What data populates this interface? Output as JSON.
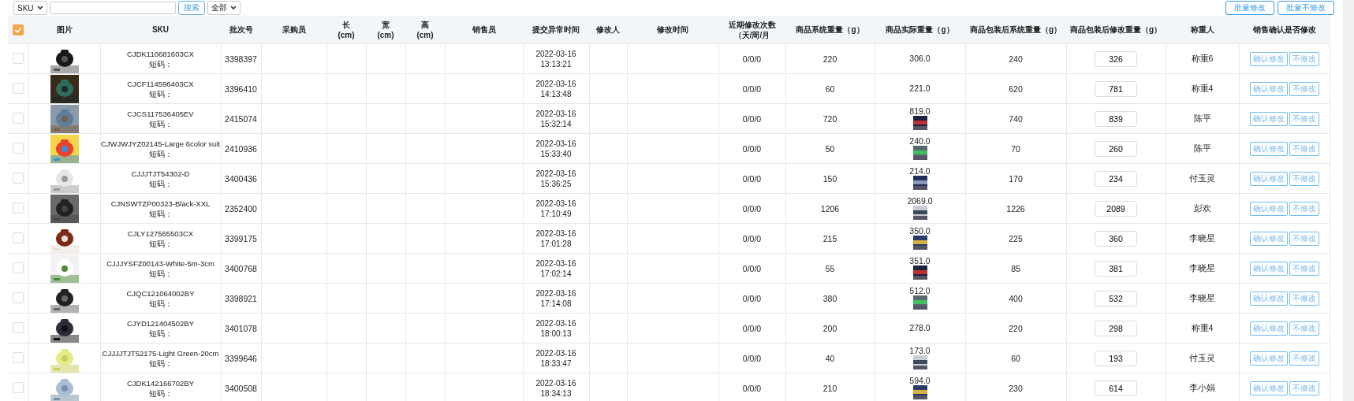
{
  "toolbar": {
    "search_type": "SKU",
    "search_button": "搜索",
    "filter": "全部",
    "batch_buttons": [
      "批量修改",
      "批量不修改"
    ]
  },
  "table": {
    "header_checked": true,
    "columns": [
      "图片",
      "SKU",
      "批次号",
      "采购员",
      "长 (cm)",
      "宽 (cm)",
      "高 (cm)",
      "销售员",
      "提交异常时间",
      "修改人",
      "修改时间",
      "近期修改次数（天/周/月",
      "商品系统重量（g）",
      "商品实际重量（g）",
      "商品包装后系统重量（g）",
      "商品包装后修改重量（g）",
      "称重人",
      "销售确认是否修改"
    ],
    "rows": [
      {
        "checked": false,
        "sku": "CJDK110681603CX",
        "short_code": "短码：",
        "batch": "3398397",
        "submitted": "2022-03-16 13:13:21",
        "recent_changes": "0/0/0",
        "system_weight": "220",
        "actual_weight": "306.0",
        "actual_photo": false,
        "packed_system_weight": "240",
        "packed_modified_weight": "326",
        "weigher": "称重6",
        "actions": [
          "确认修改",
          "不修改"
        ]
      },
      {
        "checked": false,
        "sku": "CJCF114596403CX",
        "short_code": "短码：",
        "batch": "3396410",
        "submitted": "2022-03-16 14:13:48",
        "recent_changes": "0/0/0",
        "system_weight": "60",
        "actual_weight": "221.0",
        "actual_photo": false,
        "packed_system_weight": "620",
        "packed_modified_weight": "781",
        "weigher": "称重4",
        "actions": [
          "确认修改",
          "不修改"
        ]
      },
      {
        "checked": false,
        "sku": "CJCS117536405EV",
        "short_code": "短码：",
        "batch": "2415074",
        "submitted": "2022-03-16 15:32:14",
        "recent_changes": "0/0/0",
        "system_weight": "720",
        "actual_weight": "819.0",
        "actual_photo": true,
        "packed_system_weight": "740",
        "packed_modified_weight": "839",
        "weigher": "陈平",
        "actions": [
          "确认修改",
          "不修改"
        ]
      },
      {
        "checked": false,
        "sku": "CJWJWJYZ02145-Large 6color suit",
        "short_code": "短码：",
        "batch": "2410936",
        "submitted": "2022-03-16 15:33:40",
        "recent_changes": "0/0/0",
        "system_weight": "50",
        "actual_weight": "240.0",
        "actual_photo": true,
        "packed_system_weight": "70",
        "packed_modified_weight": "260",
        "weigher": "陈平",
        "actions": [
          "确认修改",
          "不修改"
        ]
      },
      {
        "checked": false,
        "sku": "CJJJTJT54302-D",
        "short_code": "短码：",
        "batch": "3400436",
        "submitted": "2022-03-16 15:36:25",
        "recent_changes": "0/0/0",
        "system_weight": "150",
        "actual_weight": "214.0",
        "actual_photo": true,
        "packed_system_weight": "170",
        "packed_modified_weight": "234",
        "weigher": "付玉灵",
        "actions": [
          "确认修改",
          "不修改"
        ]
      },
      {
        "checked": false,
        "sku": "CJNSWTZP00323-Black-XXL",
        "short_code": "短码：",
        "batch": "2352400",
        "submitted": "2022-03-16 17:10:49",
        "recent_changes": "0/0/0",
        "system_weight": "1206",
        "actual_weight": "2069.0",
        "actual_photo": true,
        "packed_system_weight": "1226",
        "packed_modified_weight": "2089",
        "weigher": "彭欢",
        "actions": [
          "确认修改",
          "不修改"
        ]
      },
      {
        "checked": false,
        "sku": "CJLY127565503CX",
        "short_code": "短码：",
        "batch": "3399175",
        "submitted": "2022-03-16 17:01:28",
        "recent_changes": "0/0/0",
        "system_weight": "215",
        "actual_weight": "350.0",
        "actual_photo": true,
        "packed_system_weight": "225",
        "packed_modified_weight": "360",
        "weigher": "李晓星",
        "actions": [
          "确认修改",
          "不修改"
        ]
      },
      {
        "checked": false,
        "sku": "CJJJYSFZ00143-White-5m-3cm",
        "short_code": "短码：",
        "batch": "3400768",
        "submitted": "2022-03-16 17:02:14",
        "recent_changes": "0/0/0",
        "system_weight": "55",
        "actual_weight": "351.0",
        "actual_photo": true,
        "packed_system_weight": "85",
        "packed_modified_weight": "381",
        "weigher": "李晓星",
        "actions": [
          "确认修改",
          "不修改"
        ]
      },
      {
        "checked": false,
        "sku": "CJQC121064002BY",
        "short_code": "短码：",
        "batch": "3398921",
        "submitted": "2022-03-16 17:14:08",
        "recent_changes": "0/0/0",
        "system_weight": "380",
        "actual_weight": "512.0",
        "actual_photo": true,
        "packed_system_weight": "400",
        "packed_modified_weight": "532",
        "weigher": "李晓星",
        "actions": [
          "确认修改",
          "不修改"
        ]
      },
      {
        "checked": false,
        "sku": "CJYD121404502BY",
        "short_code": "短码：",
        "batch": "3401078",
        "submitted": "2022-03-16 18:00:13",
        "recent_changes": "0/0/0",
        "system_weight": "200",
        "actual_weight": "278.0",
        "actual_photo": false,
        "packed_system_weight": "220",
        "packed_modified_weight": "298",
        "weigher": "称重4",
        "actions": [
          "确认修改",
          "不修改"
        ]
      },
      {
        "checked": false,
        "sku": "CJJJJTJT52175-Light Green-20cm",
        "short_code": "短码：",
        "batch": "3399646",
        "submitted": "2022-03-16 18:33:47",
        "recent_changes": "0/0/0",
        "system_weight": "40",
        "actual_weight": "173.0",
        "actual_photo": true,
        "packed_system_weight": "60",
        "packed_modified_weight": "193",
        "weigher": "付玉灵",
        "actions": [
          "确认修改",
          "不修改"
        ]
      },
      {
        "checked": false,
        "sku": "CJDK142166702BY",
        "short_code": "短码：",
        "batch": "3400508",
        "submitted": "2022-03-16 18:34:13",
        "recent_changes": "0/0/0",
        "system_weight": "210",
        "actual_weight": "594.0",
        "actual_photo": true,
        "packed_system_weight": "230",
        "packed_modified_weight": "614",
        "weigher": "李小娟",
        "actions": [
          "确认修改",
          "不修改"
        ]
      }
    ]
  }
}
